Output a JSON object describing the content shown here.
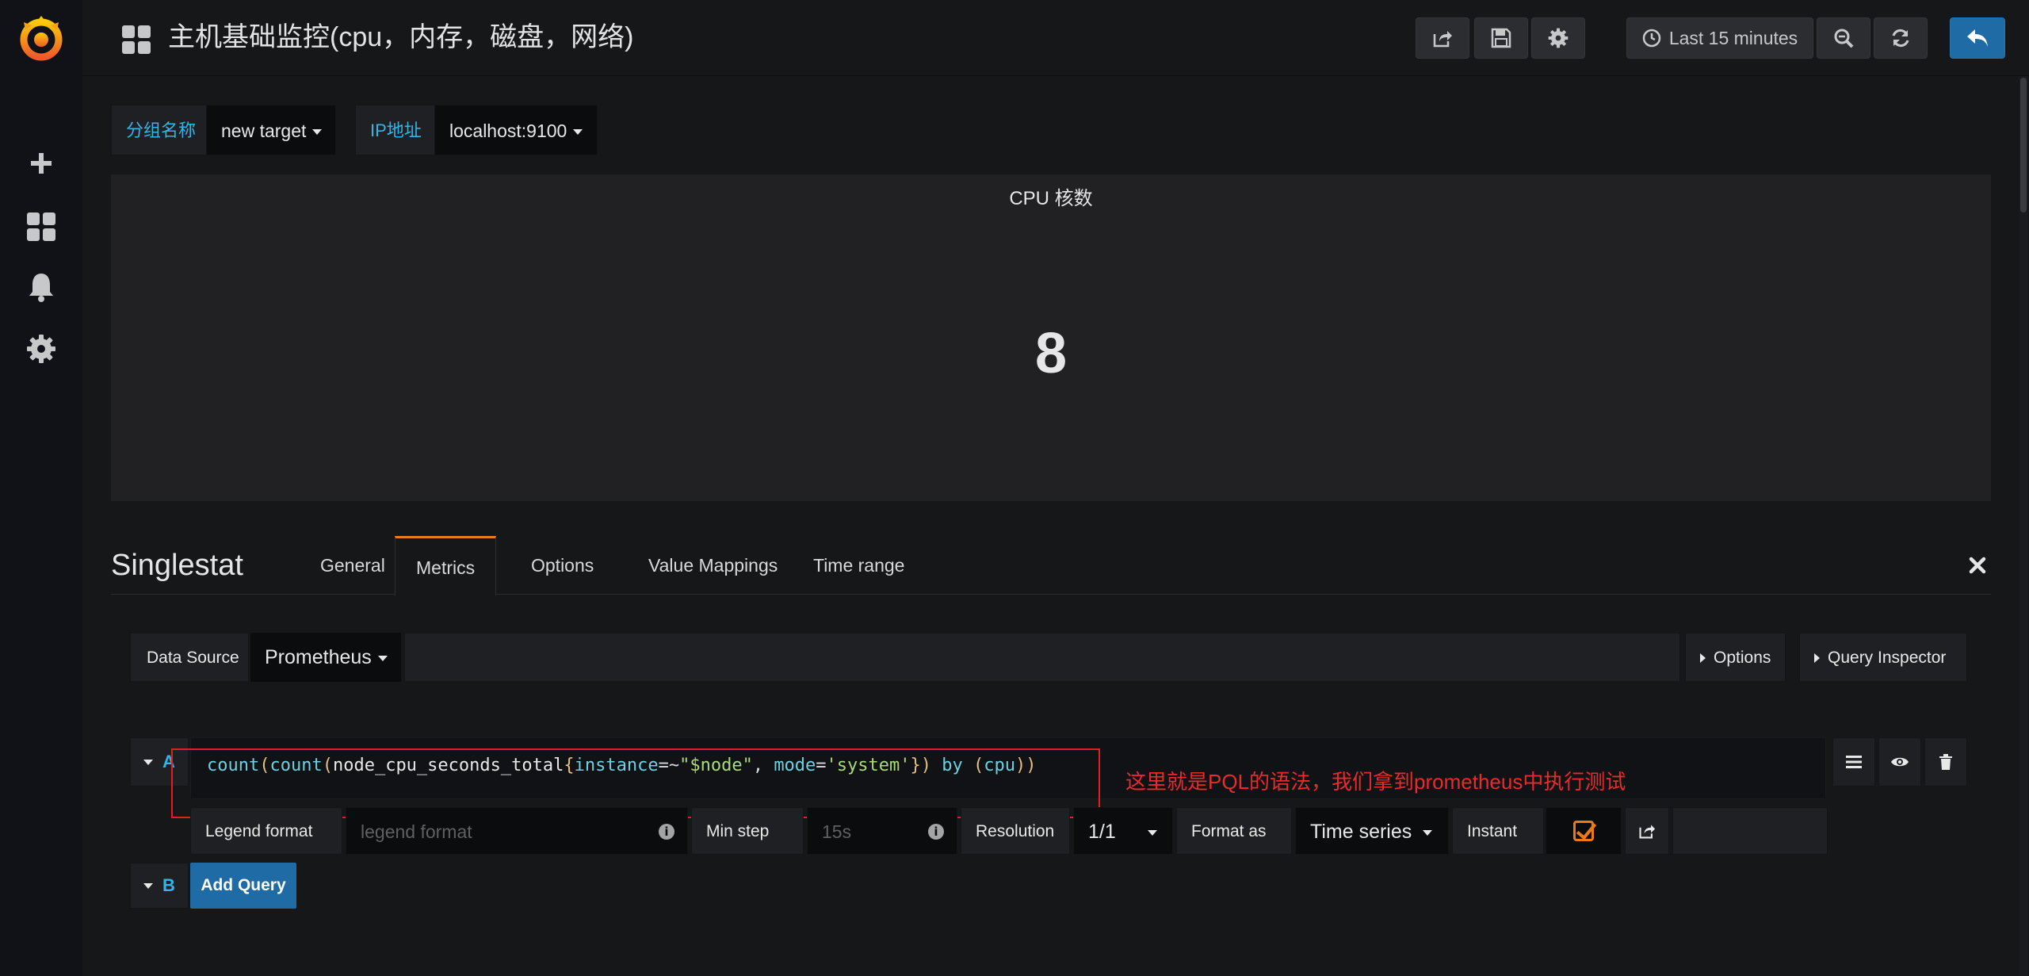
{
  "navbar": {
    "dashboard_title": "主机基础监控(cpu，内存，磁盘，网络)",
    "time_range_label": "Last 15 minutes",
    "icons": [
      "share-icon",
      "save-icon",
      "settings-icon",
      "clock-icon",
      "zoom-out-icon",
      "refresh-icon",
      "back-icon"
    ]
  },
  "sidebar": {
    "icons": [
      "grafana-logo",
      "plus-icon",
      "dashboards-icon",
      "bell-icon",
      "gear-icon"
    ]
  },
  "variables": [
    {
      "label": "分组名称",
      "value": "new target"
    },
    {
      "label": "IP地址",
      "value": "localhost:9100"
    }
  ],
  "panel": {
    "title": "CPU 核数",
    "value": "8"
  },
  "editor": {
    "title": "Singlestat",
    "tabs": [
      "General",
      "Metrics",
      "Options",
      "Value Mappings",
      "Time range"
    ],
    "active_tab": "Metrics"
  },
  "datasource": {
    "label": "Data Source",
    "value": "Prometheus",
    "options_btn": "Options",
    "inspector_btn": "Query Inspector"
  },
  "queries": {
    "a": {
      "letter": "A",
      "tokens": [
        "count",
        "(",
        "count",
        "(",
        "node_cpu_seconds_total",
        "{",
        "instance",
        "=~",
        "\"$node\"",
        ", ",
        "mode",
        "=",
        "'system'",
        "}",
        ")",
        " by ",
        "(",
        "cpu",
        ")",
        ")"
      ],
      "legend_label": "Legend format",
      "legend_placeholder": "legend format",
      "minstep_label": "Min step",
      "minstep_placeholder": "15s",
      "resolution_label": "Resolution",
      "resolution_value": "1/1",
      "format_label": "Format as",
      "format_value": "Time series",
      "instant_label": "Instant",
      "instant_checked": true
    },
    "b": {
      "letter": "B",
      "add_label": "Add Query"
    }
  },
  "annotation": {
    "text": "这里就是PQL的语法，我们拿到prometheus中执行测试",
    "color": "#ea2a2a"
  },
  "colors": {
    "accent_orange": "#eb7b18",
    "primary_blue": "#1e6ba5",
    "variable_label_blue": "#33b5e5"
  }
}
